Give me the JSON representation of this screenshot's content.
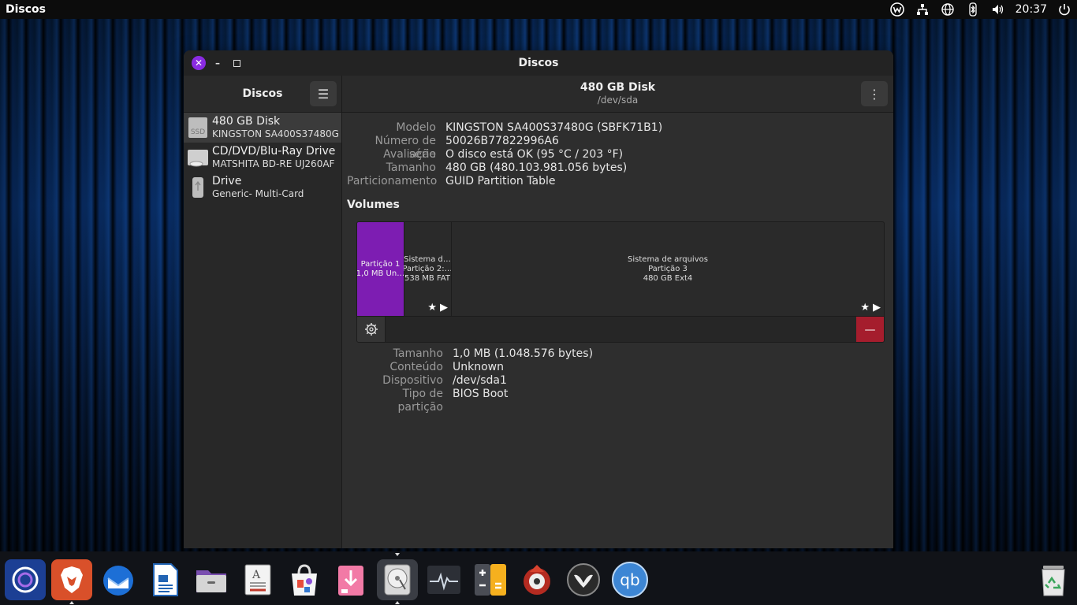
{
  "topbar": {
    "app_name": "Discos",
    "clock": "20:37"
  },
  "window": {
    "title": "Discos"
  },
  "sidebar": {
    "title": "Discos",
    "menu_icon": "hamburger-menu-icon",
    "disks": [
      {
        "name": "480 GB Disk",
        "model": "KINGSTON SA400S37480G",
        "icon": "ssd-icon",
        "icon_text": "SSD"
      },
      {
        "name": "CD/DVD/Blu-Ray Drive",
        "model": "MATSHITA BD-RE UJ260AF",
        "icon": "optical-drive-icon"
      },
      {
        "name": "Drive",
        "model": "Generic- Multi-Card",
        "icon": "usb-drive-icon"
      }
    ]
  },
  "main": {
    "title": "480 GB Disk",
    "subtitle": "/dev/sda",
    "properties": [
      {
        "label": "Modelo",
        "value": "KINGSTON SA400S37480G (SBFK71B1)"
      },
      {
        "label": "Número de série",
        "value": "50026B77822996A6"
      },
      {
        "label": "Avaliação",
        "value": "O disco está OK (95 °C / 203 °F)"
      },
      {
        "label": "Tamanho",
        "value": "480 GB (480.103.981.056 bytes)"
      },
      {
        "label": "Particionamento",
        "value": "GUID Partition Table"
      }
    ],
    "volumes_title": "Volumes",
    "volumes": [
      {
        "line1": "Partição 1",
        "line2": "1,0 MB Un…",
        "selected": true
      },
      {
        "line1": "Sistema d…",
        "line2": "Partição 2:…",
        "line3": "538 MB FAT",
        "selected": false
      },
      {
        "line1": "Sistema de arquivos",
        "line2": "Partição 3",
        "line3": "480 GB Ext4",
        "selected": false
      }
    ],
    "volume_properties": [
      {
        "label": "Tamanho",
        "value": "1,0 MB (1.048.576 bytes)"
      },
      {
        "label": "Conteúdo",
        "value": "Unknown"
      },
      {
        "label": "Dispositivo",
        "value": "/dev/sda1"
      },
      {
        "label": "Tipo de partição",
        "value": "BIOS Boot"
      }
    ]
  },
  "dock": {
    "apps": [
      "ubuntu-show-apps-icon",
      "brave-browser-icon",
      "thunderbird-icon",
      "libreoffice-writer-icon",
      "files-icon",
      "document-viewer-icon",
      "software-center-icon",
      "package-installer-icon",
      "disks-icon",
      "system-monitor-icon",
      "calculator-icon",
      "transmission-icon",
      "app-icon",
      "qbittorrent-icon",
      "trash-icon"
    ],
    "qbittorrent_text": "qb"
  },
  "colors": {
    "accent": "#7d1db2",
    "close_button": "#8a2be2",
    "destructive": "#a51d2d"
  }
}
